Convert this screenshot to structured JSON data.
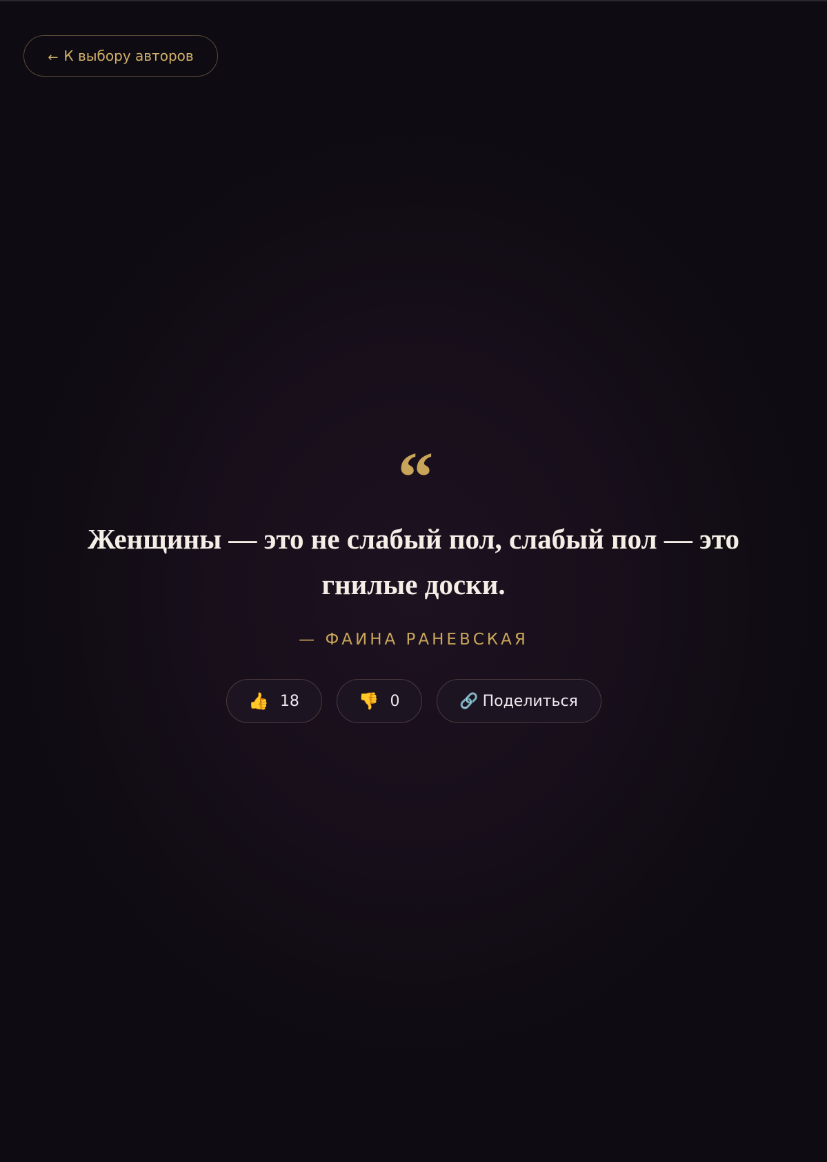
{
  "nav": {
    "back_arrow": "←",
    "back_label": "К выбору авторов"
  },
  "quote": {
    "mark": "“",
    "text": "Женщины — это не слабый пол, слабый пол — это гнилые доски.",
    "author": "— Фаина Раневская"
  },
  "actions": {
    "like_icon": "👍",
    "like_count": "18",
    "dislike_icon": "👎",
    "dislike_count": "0",
    "share_icon": "🔗",
    "share_label": "Поделиться"
  },
  "colors": {
    "accent_gold": "#c9a55a",
    "text_light": "#f4eee6",
    "background": "#110c14"
  }
}
